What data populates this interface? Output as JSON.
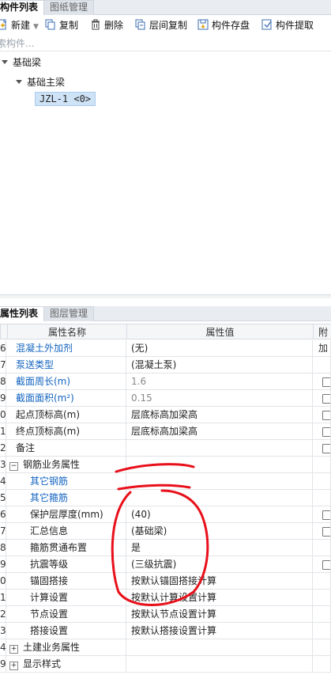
{
  "top_tabs": {
    "component_list": "构件列表",
    "drawing_mgmt": "图纸管理"
  },
  "toolbar": {
    "new": "新建",
    "copy": "复制",
    "delete": "删除",
    "floor_copy": "层间复制",
    "save": "构件存盘",
    "extract": "构件提取"
  },
  "search": {
    "placeholder": "索构件..."
  },
  "tree": {
    "root": "基础梁",
    "child": "基础主梁",
    "item": "JZL-1 <0>"
  },
  "bottom_tabs": {
    "properties": "属性列表",
    "layer_mgmt": "图层管理"
  },
  "grid": {
    "col_name": "属性名称",
    "col_value": "属性值",
    "col_extra": "附加",
    "rows": [
      {
        "num": "6",
        "name": "混凝土外加剂",
        "value": "(无)",
        "blue": true,
        "check": false
      },
      {
        "num": "7",
        "name": "泵送类型",
        "value": "(混凝土泵)",
        "blue": true,
        "check": false
      },
      {
        "num": "8",
        "name": "截面周长(m)",
        "value": "1.6",
        "blue": true,
        "check": true
      },
      {
        "num": "9",
        "name": "截面面积(m²)",
        "value": "0.15",
        "blue": true,
        "check": true
      },
      {
        "num": "0",
        "name": "起点顶标高(m)",
        "value": "层底标高加梁高",
        "check": true
      },
      {
        "num": "1",
        "name": "终点顶标高(m)",
        "value": "层底标高加梁高",
        "check": true
      },
      {
        "num": "2",
        "name": "备注",
        "value": "",
        "check": true
      },
      {
        "num": "3",
        "name": "钢筋业务属性",
        "value": "",
        "group": "minus"
      },
      {
        "num": "4",
        "name": "其它钢筋",
        "value": "",
        "blue": true,
        "indent": true
      },
      {
        "num": "5",
        "name": "其它箍筋",
        "value": "",
        "blue": true,
        "indent": true
      },
      {
        "num": "6",
        "name": "保护层厚度(mm)",
        "value": "(40)",
        "indent": true,
        "check": true
      },
      {
        "num": "7",
        "name": "汇总信息",
        "value": "(基础梁)",
        "indent": true,
        "check": true
      },
      {
        "num": "8",
        "name": "箍筋贯通布置",
        "value": "是",
        "indent": true
      },
      {
        "num": "9",
        "name": "抗震等级",
        "value": "(三级抗震)",
        "indent": true,
        "check": true
      },
      {
        "num": "0",
        "name": "锚固搭接",
        "value": "按默认锚固搭接计算",
        "indent": true
      },
      {
        "num": "1",
        "name": "计算设置",
        "value": "按默认计算设置计算",
        "indent": true
      },
      {
        "num": "2",
        "name": "节点设置",
        "value": "按默认节点设置计算",
        "indent": true
      },
      {
        "num": "3",
        "name": "搭接设置",
        "value": "按默认搭接设置计算",
        "indent": true
      },
      {
        "num": "4",
        "name": "土建业务属性",
        "value": "",
        "group": "plus"
      },
      {
        "num": "9",
        "name": "显示样式",
        "value": "",
        "group": "plus"
      }
    ]
  },
  "colors": {
    "accent_blue": "#1565c0",
    "selection": "#cfe3f6",
    "annotation_red": "#e8101a"
  }
}
